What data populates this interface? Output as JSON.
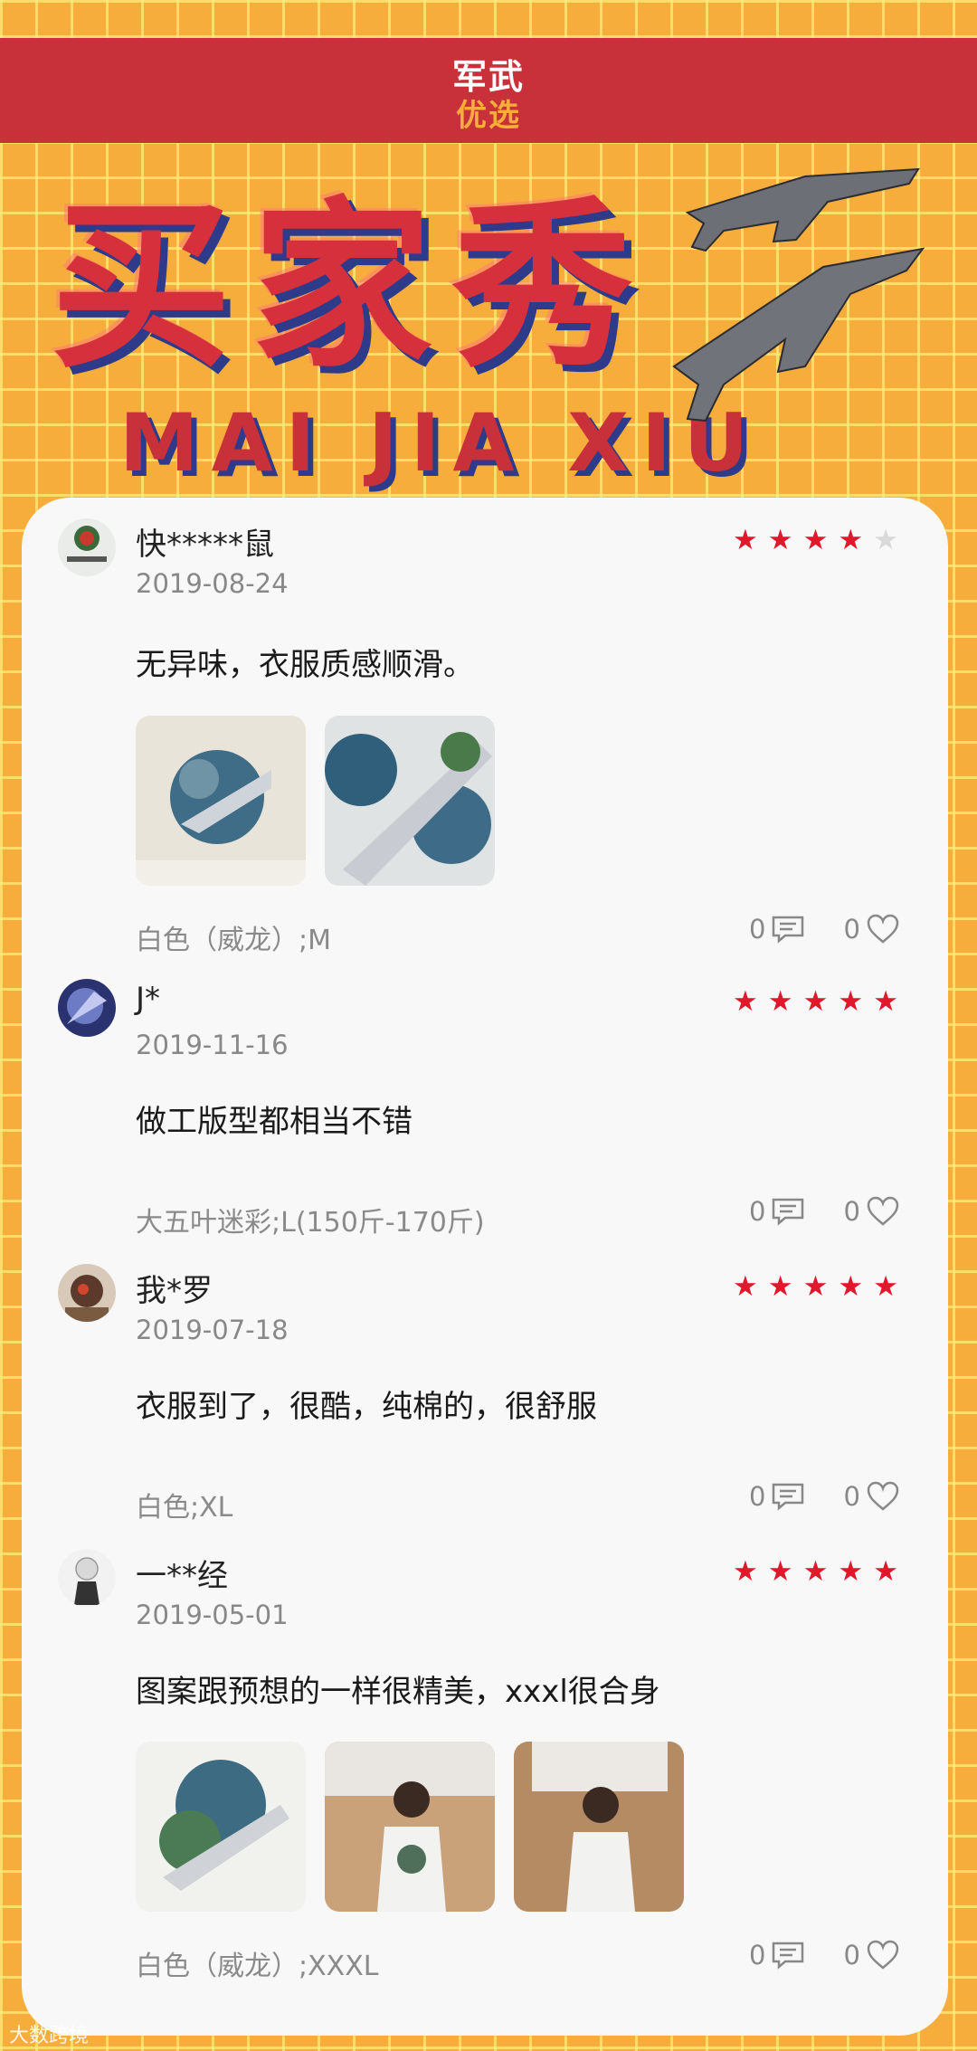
{
  "header": {
    "brand_top": "军武",
    "brand_bottom": "优选"
  },
  "hero": {
    "title": "买家秀",
    "subtitle": "MAI JIA XIU"
  },
  "colors": {
    "header_bg": "#c8303a",
    "page_bg": "#f7ad3c",
    "star": "#e0182c",
    "title_shadow": "#2e3a8a"
  },
  "reviews": [
    {
      "user": "快*****鼠",
      "date": "2019-08-24",
      "rating": 4,
      "text": "无异味，衣服质感顺滑。",
      "photos": 2,
      "variant": "白色（威龙）;M",
      "comments": "0",
      "likes": "0"
    },
    {
      "user": "J*",
      "date": "2019-11-16",
      "rating": 5,
      "text": "做工版型都相当不错",
      "photos": 0,
      "variant": "大五叶迷彩;L(150斤-170斤)",
      "comments": "0",
      "likes": "0"
    },
    {
      "user": "我*罗",
      "date": "2019-07-18",
      "rating": 5,
      "text": "衣服到了，很酷，纯棉的，很舒服",
      "photos": 0,
      "variant": "白色;XL",
      "comments": "0",
      "likes": "0"
    },
    {
      "user": "一**经",
      "date": "2019-05-01",
      "rating": 5,
      "text": "图案跟预想的一样很精美，xxxl很合身",
      "photos": 3,
      "variant": "白色（威龙）;XXXL",
      "comments": "0",
      "likes": "0"
    }
  ],
  "watermark": "大数跨境"
}
